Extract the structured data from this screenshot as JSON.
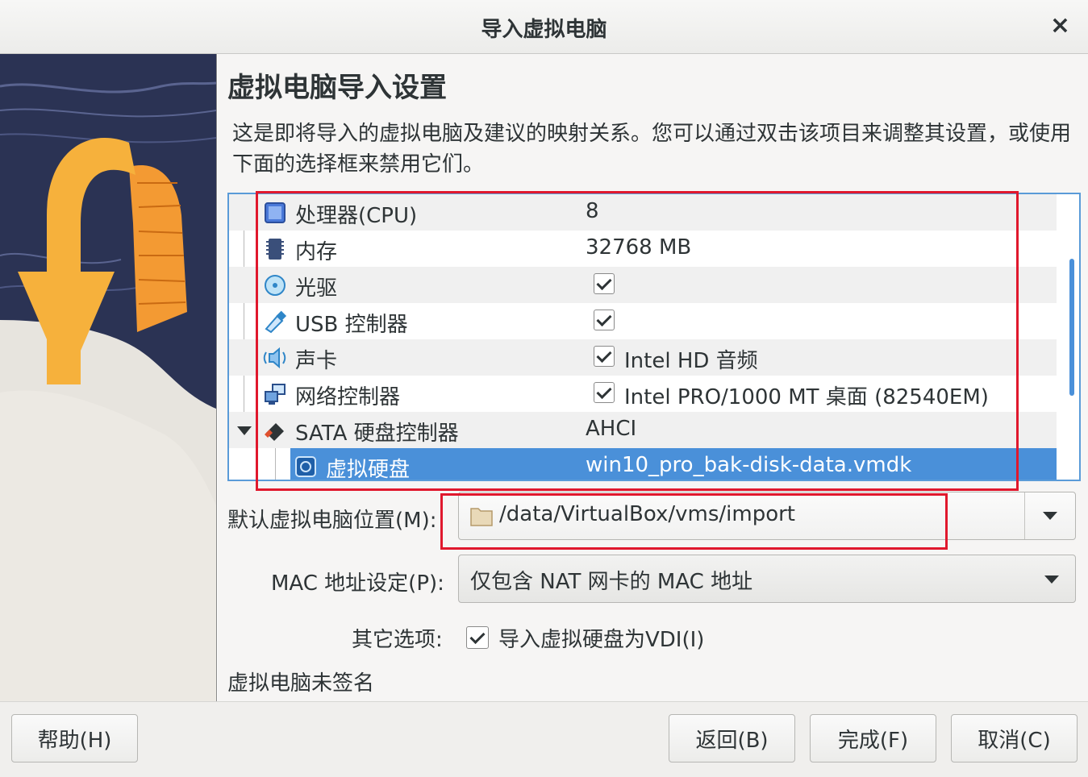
{
  "window": {
    "title": "导入虚拟电脑",
    "close_label": "×"
  },
  "heading": "虚拟电脑导入设置",
  "description": "这是即将导入的虚拟电脑及建议的映射关系。您可以通过双击该项目来调整其设置，或使用下面的选择框来禁用它们。",
  "tree": {
    "rows": [
      {
        "name": "处理器(CPU)",
        "value": "8",
        "icon": "cpu-icon"
      },
      {
        "name": "内存",
        "value": "32768 MB",
        "icon": "memory-icon"
      },
      {
        "name": "光驱",
        "checked": true,
        "icon": "optical-drive-icon"
      },
      {
        "name": "USB 控制器",
        "checked": true,
        "icon": "usb-icon"
      },
      {
        "name": "声卡",
        "checked": true,
        "value": "Intel HD 音频",
        "icon": "sound-card-icon"
      },
      {
        "name": "网络控制器",
        "checked": true,
        "value": "Intel PRO/1000 MT 桌面 (82540EM)",
        "icon": "network-icon"
      },
      {
        "name": "SATA 硬盘控制器",
        "value": "AHCI",
        "icon": "sata-controller-icon",
        "expanded": true
      },
      {
        "name": "虚拟硬盘",
        "value": "win10_pro_bak-disk-data.vmdk",
        "icon": "hard-disk-icon",
        "selected": true
      }
    ]
  },
  "form": {
    "location_label": "默认虚拟电脑位置(M):",
    "location_value": "/data/VirtualBox/vms/import",
    "mac_label": "MAC 地址设定(P):",
    "mac_value": "仅包含 NAT 网卡的 MAC 地址",
    "other_label": "其它选项:",
    "import_vdi_label": "导入虚拟硬盘为VDI(I)",
    "import_vdi_checked": true,
    "unsigned_text": "虚拟电脑未签名"
  },
  "buttons": {
    "help": "帮助(H)",
    "back": "返回(B)",
    "finish": "完成(F)",
    "cancel": "取消(C)"
  },
  "colors": {
    "accent": "#4a90d9",
    "highlight_box": "#e0182d",
    "banner_arrow": "#f6b13c",
    "banner_night": "#2b3354"
  }
}
